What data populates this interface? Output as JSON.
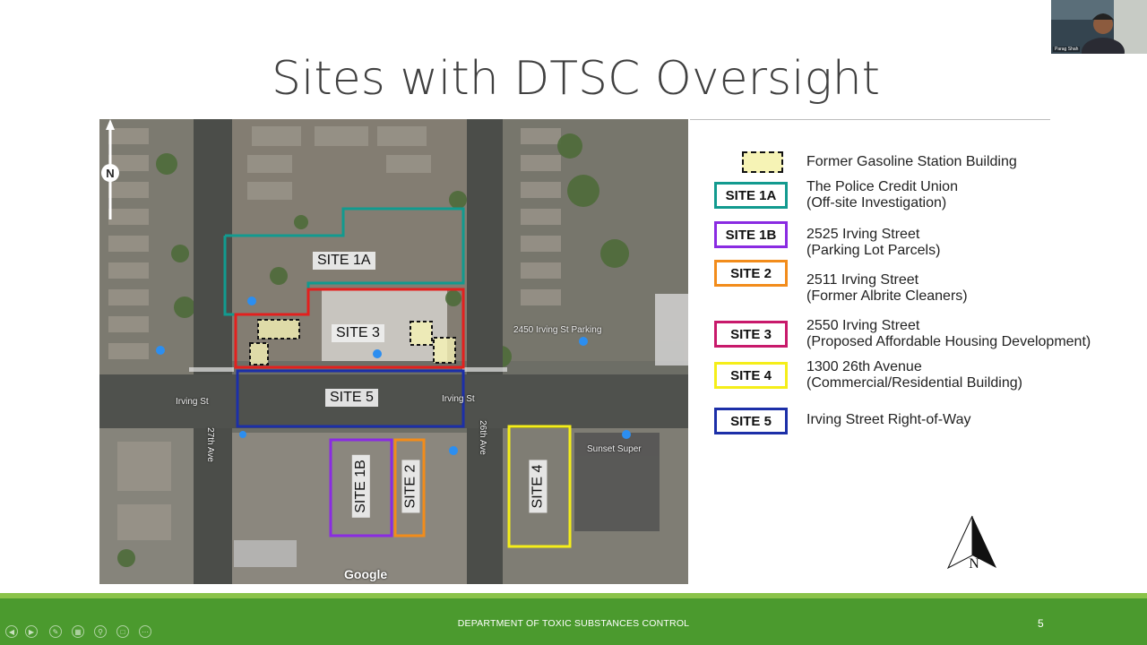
{
  "slide": {
    "title": "Sites with DTSC Oversight",
    "footer": "DEPARTMENT OF TOXIC SUBSTANCES CONTROL",
    "page_number": "5"
  },
  "map": {
    "sites": {
      "site1a": "SITE 1A",
      "site1b": "SITE 1B",
      "site2": "SITE 2",
      "site3": "SITE 3",
      "site4": "SITE 4",
      "site5": "SITE 5"
    },
    "streets": {
      "irving_left": "Irving St",
      "irving_right": "Irving St",
      "ave_27th": "27th Ave",
      "ave_26th": "26th Ave",
      "parking": "2450 Irving St Parking",
      "sunset": "Sunset Super"
    },
    "attribution": "Google",
    "north_label": "N"
  },
  "legend": {
    "items": [
      {
        "key": "",
        "text1": "Former Gasoline Station Building",
        "text2": "",
        "color": "#111111"
      },
      {
        "key": "SITE 1A",
        "text1": "The Police Credit Union",
        "text2": "(Off-site Investigation)",
        "color": "#129a8f"
      },
      {
        "key": "SITE 1B",
        "text1": "2525 Irving Street",
        "text2": "(Parking Lot Parcels)",
        "color": "#8a2be2"
      },
      {
        "key": "SITE 2",
        "text1": "2511 Irving Street",
        "text2": "(Former Albrite Cleaners)",
        "color": "#f28c1b"
      },
      {
        "key": "SITE 3",
        "text1": "2550 Irving Street",
        "text2": "(Proposed Affordable Housing Development)",
        "color": "#c8196b"
      },
      {
        "key": "SITE 4",
        "text1": "1300 26th Avenue",
        "text2": "(Commercial/Residential Building)",
        "color": "#f5ee19"
      },
      {
        "key": "SITE 5",
        "text1": "Irving Street Right-of-Way",
        "text2": "",
        "color": "#1c2fa8"
      }
    ],
    "north_label": "N"
  },
  "webcam": {
    "name": "Parag Shah"
  }
}
